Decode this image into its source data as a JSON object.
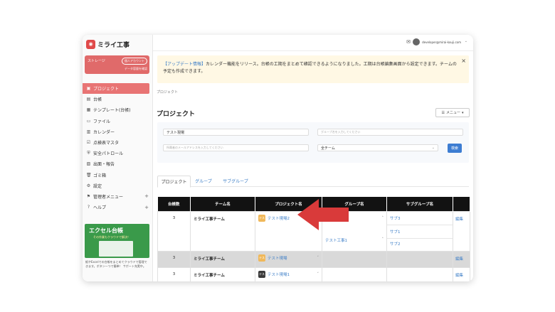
{
  "logo": {
    "text": "ミライ工事"
  },
  "storage": {
    "label": "ストレージ",
    "button": "個人アカウント",
    "sub": "データ容量を確認"
  },
  "nav": {
    "items": [
      {
        "label": "プロジェクト",
        "icon": "project-icon"
      },
      {
        "label": "台帳",
        "icon": "ledger-icon"
      },
      {
        "label": "テンプレート(台帳)",
        "icon": "template-icon"
      },
      {
        "label": "ファイル",
        "icon": "file-icon"
      },
      {
        "label": "カレンダー",
        "icon": "calendar-icon"
      },
      {
        "label": "点検表マスタ",
        "icon": "checklist-icon"
      },
      {
        "label": "安全パトロール",
        "icon": "safety-icon"
      },
      {
        "label": "出面・報告",
        "icon": "report-icon"
      },
      {
        "label": "ゴミ箱",
        "icon": "trash-icon"
      },
      {
        "label": "設定",
        "icon": "gear-icon"
      },
      {
        "label": "管理者メニュー",
        "icon": "admin-icon",
        "plus": "+"
      },
      {
        "label": "ヘルプ",
        "icon": "help-icon",
        "plus": "+"
      }
    ]
  },
  "promo": {
    "title": "エクセル台帳",
    "subtitle": "その作業もクラウドで解決！",
    "text": "紙やExcelでの台帳をまとめてクラウドで管理できます。ボタン一つで簡単！ サポート充実中。"
  },
  "topbar": {
    "email": "developer@mirai-kouji.com"
  },
  "banner": {
    "link": "【アップデート情報】",
    "message": "カレンダー機能をリリース。台帳の工期をまとめて確認できるようになりました。工期は台帳編集画面から設定できます。チームの予定も作成できます。",
    "close": "×"
  },
  "breadcrumb": "プロジェクト",
  "page_title": "プロジェクト",
  "menu_button": "メニュー",
  "filters": {
    "project_name": "テスト現場",
    "group_placeholder": "グループ名を入力してください",
    "member_placeholder": "所属者のメールアドレスを入力してください",
    "team_select": "全チーム",
    "search_button": "検索"
  },
  "tabs": [
    "プロジェクト",
    "グループ",
    "サブグループ"
  ],
  "table": {
    "headers": [
      "台帳数",
      "チーム名",
      "プロジェクト名",
      "グループ名",
      "サブグループ名",
      ""
    ],
    "rows": [
      {
        "count": "3",
        "team": "ミライ工事チーム",
        "tag": "テス",
        "tag_color": "#f0b85a",
        "project": "テスト現場2",
        "group": "",
        "group2": "テスト工事1",
        "subs": [
          "サブ3",
          "サブ1",
          "サブ2"
        ],
        "edit": "編集"
      },
      {
        "count": "3",
        "team": "ミライ工事チーム",
        "tag": "テス",
        "tag_color": "#f0b85a",
        "project": "テスト現場",
        "edit": "編集"
      },
      {
        "count": "3",
        "team": "ミライ工事チーム",
        "tag": "テス",
        "tag_color": "#3a3a3a",
        "project": "テスト現場1",
        "edit": "編集"
      }
    ]
  },
  "colors": {
    "accent": "#e87474",
    "arrow": "#d93a3a",
    "link": "#3c7ec7"
  }
}
